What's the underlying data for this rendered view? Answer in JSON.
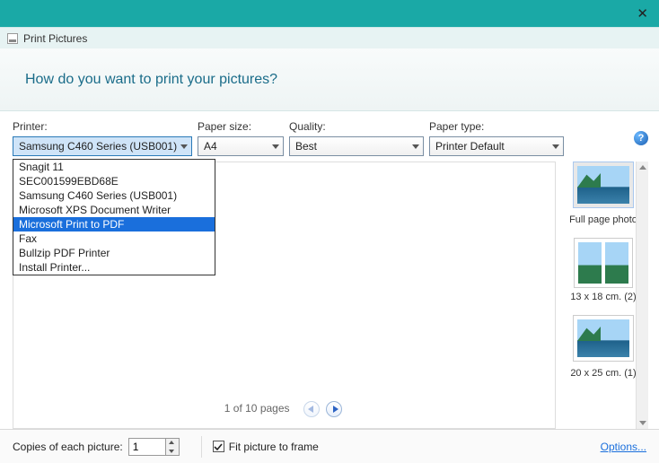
{
  "window": {
    "title": "Print Pictures"
  },
  "banner": {
    "heading": "How do you want to print your pictures?"
  },
  "controls": {
    "printer": {
      "label": "Printer:",
      "value": "Samsung C460 Series (USB001)"
    },
    "paper_size": {
      "label": "Paper size:",
      "value": "A4"
    },
    "quality": {
      "label": "Quality:",
      "value": "Best"
    },
    "paper_type": {
      "label": "Paper type:",
      "value": "Printer Default"
    }
  },
  "printer_dropdown": {
    "items": [
      "Snagit 11",
      "SEC001599EBD68E",
      "Samsung C460 Series (USB001)",
      "Microsoft XPS Document Writer",
      "Microsoft Print to PDF",
      "Fax",
      "Bullzip PDF Printer",
      "Install Printer..."
    ],
    "highlight_index": 4
  },
  "pager": {
    "text": "1 of 10 pages"
  },
  "layouts": [
    {
      "label": "Full page photo",
      "kind": "land",
      "selected": true
    },
    {
      "label": "13 x 18 cm. (2)",
      "kind": "dual",
      "selected": false
    },
    {
      "label": "20 x 25 cm. (1)",
      "kind": "land",
      "selected": false
    }
  ],
  "footer": {
    "copies_label": "Copies of each picture:",
    "copies_value": "1",
    "fit_label": "Fit picture to frame",
    "fit_checked": true,
    "options_label": "Options..."
  }
}
